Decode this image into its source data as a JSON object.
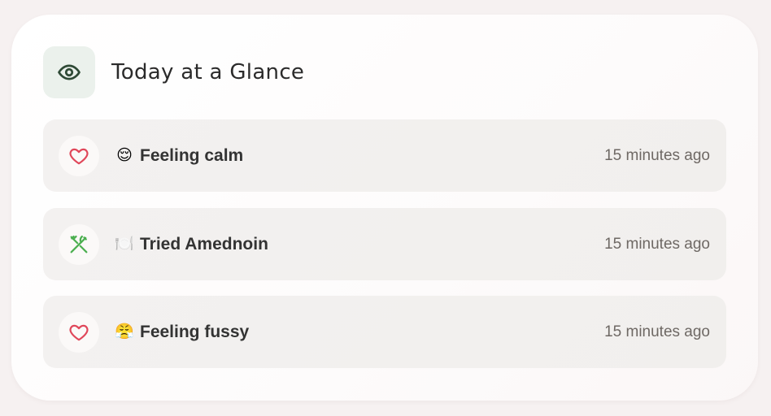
{
  "card": {
    "title": "Today at a Glance",
    "title_icon": "eye-icon"
  },
  "entries": [
    {
      "icon": "heart-icon",
      "icon_color": "#e0475a",
      "emoji": "😌",
      "label": "Feeling calm",
      "time": "15 minutes ago"
    },
    {
      "icon": "utensils-icon",
      "icon_color": "#4caf50",
      "emoji": "🍽️",
      "label": "Tried Amednoin",
      "time": "15 minutes ago"
    },
    {
      "icon": "heart-icon",
      "icon_color": "#e0475a",
      "emoji": "😤",
      "label": "Feeling fussy",
      "time": "15 minutes ago"
    }
  ],
  "colors": {
    "accent_green": "#2f4a36",
    "header_icon_bg": "#ebf1ec",
    "heart": "#e0475a",
    "utensils": "#4caf50"
  }
}
